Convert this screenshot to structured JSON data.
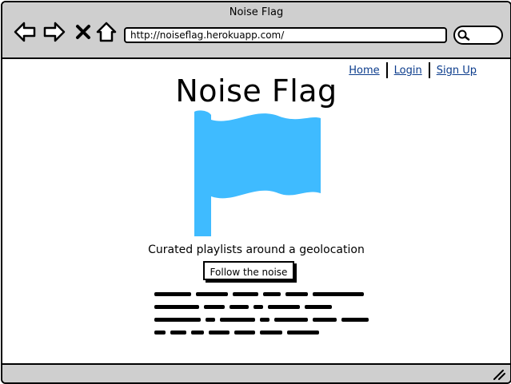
{
  "window": {
    "title": "Noise Flag"
  },
  "toolbar": {
    "back_icon": "back-arrow-icon",
    "forward_icon": "forward-arrow-icon",
    "stop_icon": "close-icon",
    "home_icon": "home-icon",
    "url": "http://noiseflag.herokuapp.com/",
    "search_icon": "search-icon"
  },
  "nav": {
    "links": [
      "Home",
      "Login",
      "Sign Up"
    ]
  },
  "hero": {
    "title": "Noise Flag",
    "flag_icon": "flag-icon",
    "flag_color": "#3fbbff",
    "tagline": "Curated playlists around a geolocation",
    "button_label": "Follow the noise"
  }
}
